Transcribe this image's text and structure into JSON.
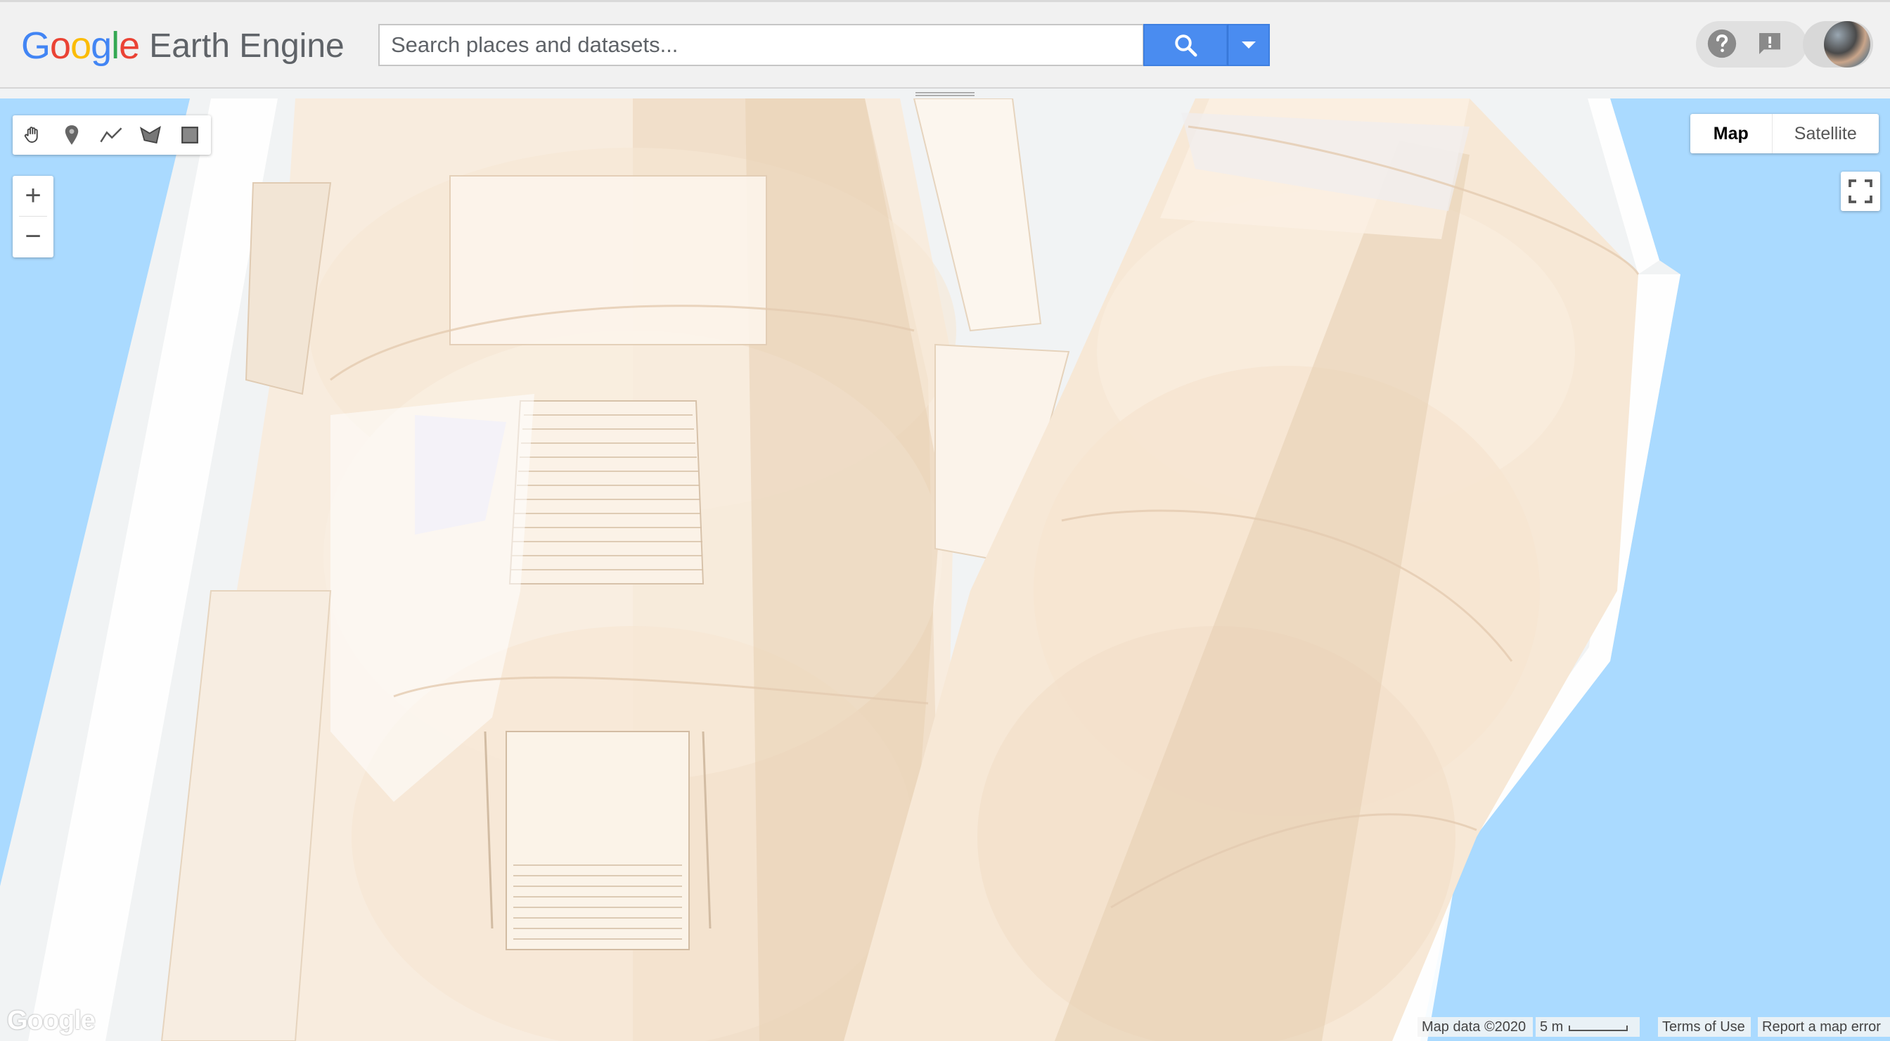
{
  "header": {
    "logo_google": "Google",
    "logo_product": "Earth Engine",
    "search_placeholder": "Search places and datasets..."
  },
  "icons": {
    "search": "search-icon",
    "dropdown": "chevron-down-icon",
    "help": "help-icon",
    "feedback": "feedback-icon",
    "avatar": "user-avatar"
  },
  "map": {
    "map_type_options": [
      "Map",
      "Satellite"
    ],
    "selected_map_type": "Map",
    "zoom_in": "+",
    "zoom_out": "−",
    "drawing_tools": [
      "hand-pan-icon",
      "marker-icon",
      "polyline-icon",
      "polygon-icon",
      "rectangle-icon"
    ],
    "google_watermark": "Google",
    "attribution": "Map data ©2020",
    "scale_label": "5 m",
    "terms": "Terms of Use",
    "report": "Report a map error"
  },
  "colors": {
    "search_button": "#4a8cf0",
    "water": "#aadaff",
    "building": "#f5e6d3",
    "land": "#f1f3f4"
  }
}
